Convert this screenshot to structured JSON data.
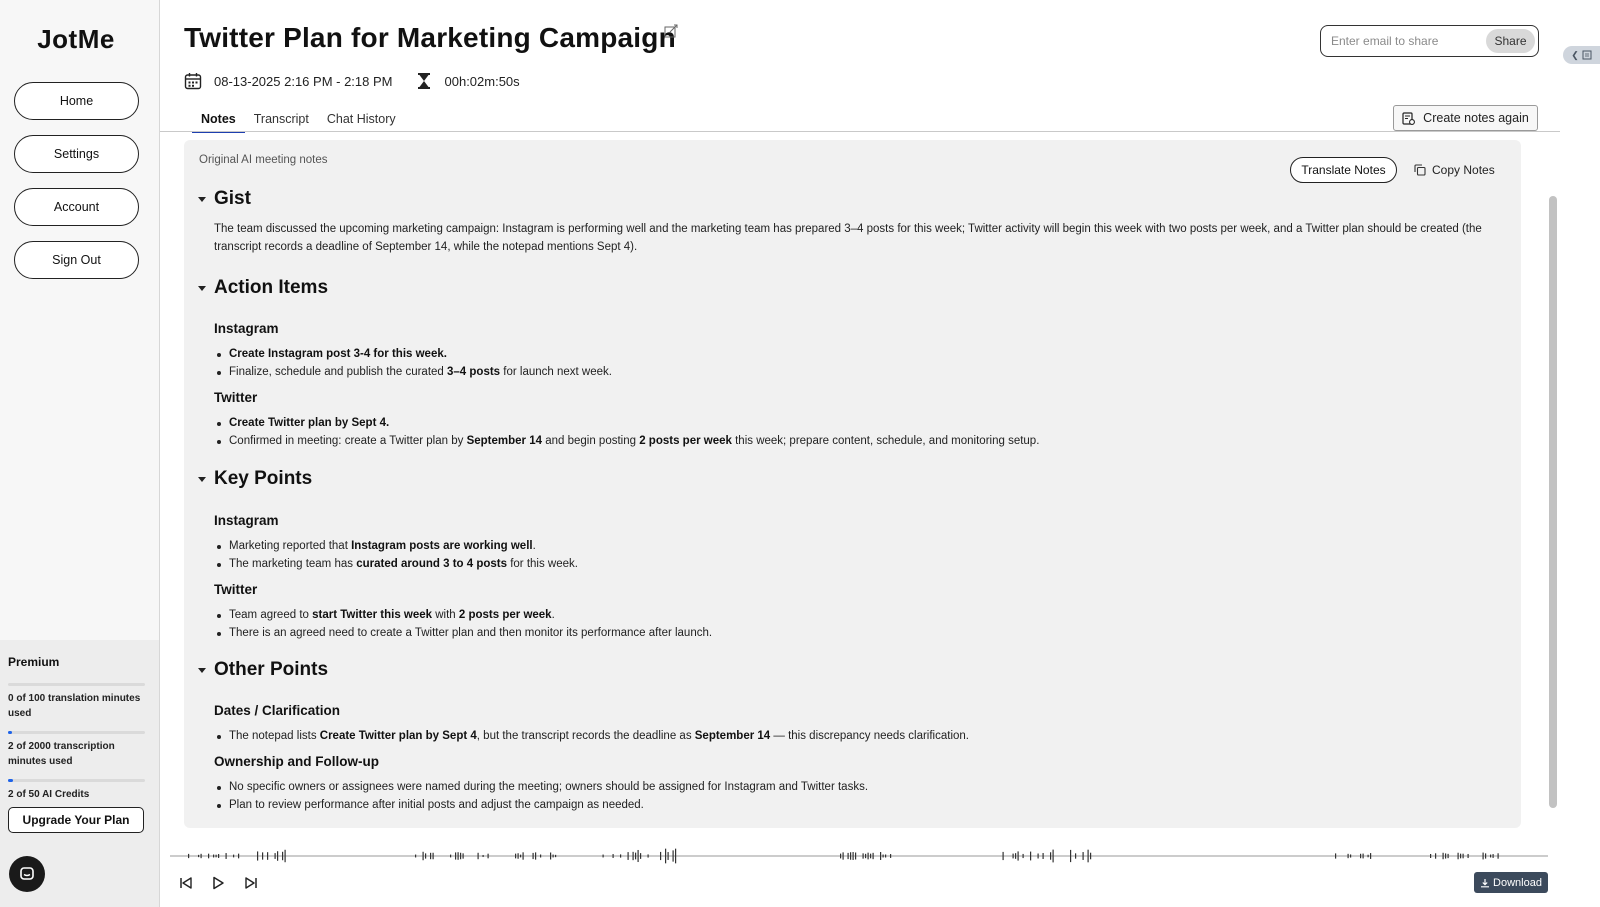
{
  "app": {
    "name": "JotMe"
  },
  "sidebar": {
    "nav": [
      {
        "label": "Home"
      },
      {
        "label": "Settings"
      },
      {
        "label": "Account"
      },
      {
        "label": "Sign Out"
      }
    ],
    "plan": {
      "name": "Premium",
      "usage": [
        {
          "text": "0 of 100 translation minutes used",
          "fraction": 0.0
        },
        {
          "text": "2 of 2000 transcription minutes used",
          "fraction": 0.001
        },
        {
          "text": "2 of 50 AI Credits",
          "fraction": 0.04
        }
      ],
      "upgrade_label": "Upgrade Your Plan"
    },
    "chat_icon": "chat-bubble-icon"
  },
  "header": {
    "title": "Twitter Plan for Marketing Campaign",
    "datetime": "08-13-2025 2:16 PM - 2:18 PM",
    "duration": "00h:02m:50s",
    "share": {
      "placeholder": "Enter email to share",
      "button_label": "Share"
    }
  },
  "tabs": [
    {
      "label": "Notes",
      "active": true
    },
    {
      "label": "Transcript",
      "active": false
    },
    {
      "label": "Chat History",
      "active": false
    }
  ],
  "create_notes_again_label": "Create notes again",
  "notes": {
    "original_label": "Original AI meeting notes",
    "translate_label": "Translate Notes",
    "copy_label": "Copy Notes",
    "gist": {
      "heading": "Gist",
      "text": "The team discussed the upcoming marketing campaign: Instagram is performing well and the marketing team has prepared 3–4 posts for this week; Twitter activity will begin this week with two posts per week, and a Twitter plan should be created (the transcript records a deadline of September 14, while the notepad mentions Sept 4)."
    },
    "action_items": {
      "heading": "Action Items",
      "instagram": {
        "heading": "Instagram",
        "item1": "Create Instagram post 3-4 for this week.",
        "item2_a": "Finalize, schedule and publish the curated ",
        "item2_b": "3–4 posts",
        "item2_c": " for launch next week."
      },
      "twitter": {
        "heading": "Twitter",
        "item1": "Create Twitter plan by Sept 4.",
        "item2_a": "Confirmed in meeting: create a Twitter plan by ",
        "item2_b": "September 14",
        "item2_c": " and begin posting ",
        "item2_d": "2 posts per week",
        "item2_e": " this week; prepare content, schedule, and monitoring setup."
      }
    },
    "key_points": {
      "heading": "Key Points",
      "instagram": {
        "heading": "Instagram",
        "item1_a": "Marketing reported that ",
        "item1_b": "Instagram posts are working well",
        "item1_c": ".",
        "item2_a": "The marketing team has ",
        "item2_b": "curated around 3 to 4 posts",
        "item2_c": " for this week."
      },
      "twitter": {
        "heading": "Twitter",
        "item1_a": "Team agreed to ",
        "item1_b": "start Twitter this week",
        "item1_c": " with ",
        "item1_d": "2 posts per week",
        "item1_e": ".",
        "item2": "There is an agreed need to create a Twitter plan and then monitor its performance after launch."
      }
    },
    "other_points": {
      "heading": "Other Points",
      "dates": {
        "heading": "Dates / Clarification",
        "item1_a": "The notepad lists ",
        "item1_b": "Create Twitter plan by Sept 4",
        "item1_c": ", but the transcript records the deadline as ",
        "item1_d": "September 14",
        "item1_e": " — this discrepancy needs clarification."
      },
      "ownership": {
        "heading": "Ownership and Follow-up",
        "item1": "No specific owners or assignees were named during the meeting; owners should be assigned for Instagram and Twitter tasks.",
        "item2": "Plan to review performance after initial posts and adjust the campaign as needed."
      }
    }
  },
  "player": {
    "controls": [
      "skip-back-icon",
      "play-icon",
      "skip-forward-icon"
    ],
    "download_label": "Download"
  },
  "colors": {
    "accent": "#1e3fb0",
    "progress": "#1e63e9",
    "download_bg": "#3c4a5c"
  }
}
